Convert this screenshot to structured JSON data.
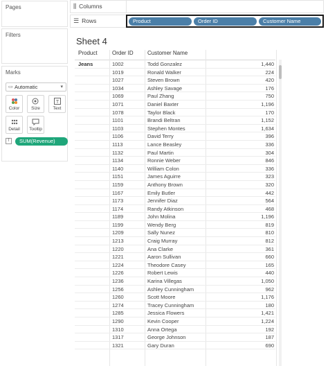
{
  "panels": {
    "pages": "Pages",
    "filters": "Filters",
    "marks": "Marks"
  },
  "marks": {
    "type": "Automatic",
    "buttons": [
      "Color",
      "Size",
      "Text",
      "Detail",
      "Tooltip"
    ],
    "pill": "SUM(Revenue)"
  },
  "shelves": {
    "columns": "Columns",
    "rows": "Rows",
    "row_pills": [
      "Product",
      "Order ID",
      "Customer Name"
    ]
  },
  "sheet": {
    "title": "Sheet 4",
    "headers": [
      "Product",
      "Order ID",
      "Customer Name"
    ],
    "product": "Jeans",
    "rows": [
      [
        "1002",
        "Todd Gonzalez",
        "1,440"
      ],
      [
        "1019",
        "Ronald Walker",
        "224"
      ],
      [
        "1027",
        "Steven Brown",
        "420"
      ],
      [
        "1034",
        "Ashley Savage",
        "176"
      ],
      [
        "1069",
        "Paul Zhang",
        "750"
      ],
      [
        "1071",
        "Daniel Baxter",
        "1,196"
      ],
      [
        "1078",
        "Taylor Black",
        "170"
      ],
      [
        "1101",
        "Brandi Beltran",
        "1,152"
      ],
      [
        "1103",
        "Stephen Montes",
        "1,634"
      ],
      [
        "1106",
        "David Terry",
        "396"
      ],
      [
        "1113",
        "Lance Beasley",
        "336"
      ],
      [
        "1132",
        "Paul Martin",
        "304"
      ],
      [
        "1134",
        "Ronnie Weber",
        "846"
      ],
      [
        "1140",
        "William Colon",
        "336"
      ],
      [
        "1151",
        "James Aguirre",
        "323"
      ],
      [
        "1159",
        "Anthony Brown",
        "320"
      ],
      [
        "1167",
        "Emily Butler",
        "442"
      ],
      [
        "1173",
        "Jennifer Diaz",
        "564"
      ],
      [
        "1174",
        "Randy Atkinson",
        "468"
      ],
      [
        "1189",
        "John Molina",
        "1,196"
      ],
      [
        "1199",
        "Wendy Berg",
        "819"
      ],
      [
        "1209",
        "Sally Nunez",
        "810"
      ],
      [
        "1213",
        "Craig Murray",
        "812"
      ],
      [
        "1220",
        "Ana Clarke",
        "361"
      ],
      [
        "1221",
        "Aaron Sullivan",
        "660"
      ],
      [
        "1224",
        "Theodore Casey",
        "165"
      ],
      [
        "1226",
        "Robert Lewis",
        "440"
      ],
      [
        "1236",
        "Karina Villegas",
        "1,050"
      ],
      [
        "1256",
        "Ashley Cunningham",
        "962"
      ],
      [
        "1260",
        "Scott Moore",
        "1,176"
      ],
      [
        "1274",
        "Tracey Cunningham",
        "180"
      ],
      [
        "1285",
        "Jessica Flowers",
        "1,421"
      ],
      [
        "1290",
        "Kevin Cooper",
        "1,224"
      ],
      [
        "1310",
        "Anna Ortega",
        "192"
      ],
      [
        "1317",
        "George Johnson",
        "187"
      ],
      [
        "1321",
        "Gary Duran",
        "690"
      ]
    ]
  }
}
